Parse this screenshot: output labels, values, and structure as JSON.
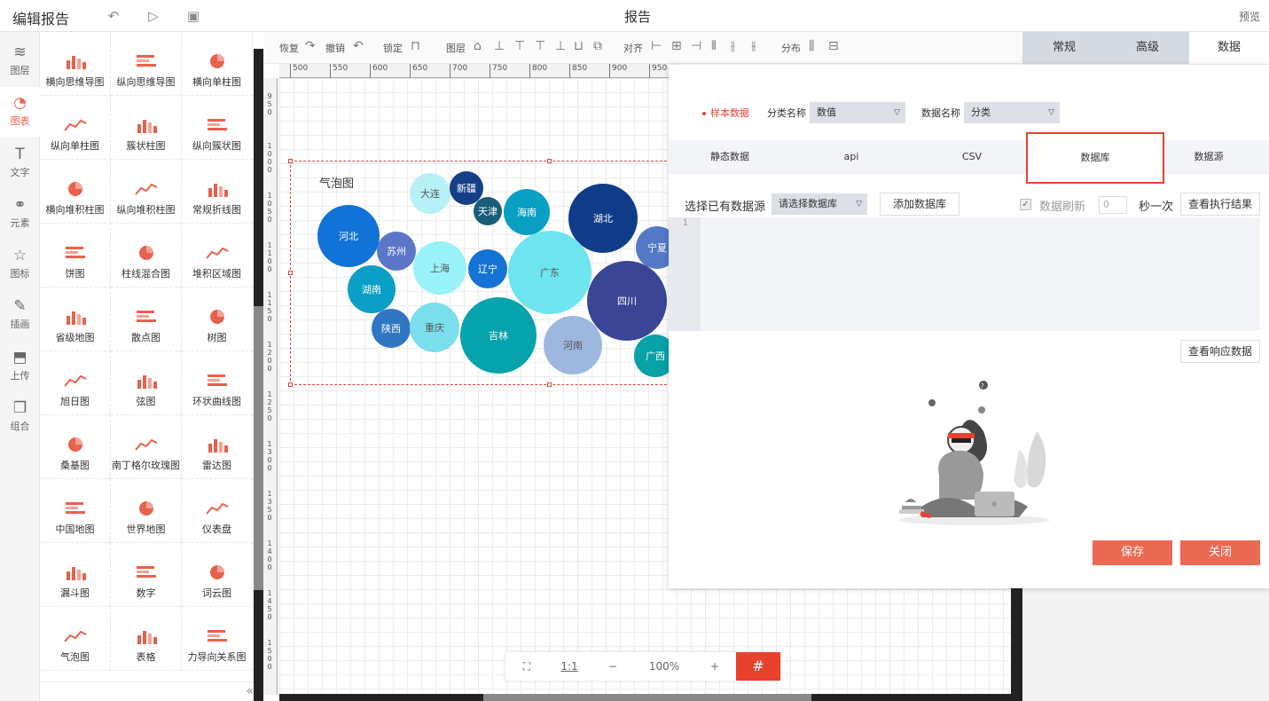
{
  "header": {
    "title": "编辑报告",
    "center": "报告",
    "preview": "预览"
  },
  "leftnav": [
    {
      "label": "图层",
      "icon": "layers-icon",
      "glyph": "≋"
    },
    {
      "label": "图表",
      "icon": "pie-chart-icon",
      "glyph": "◔"
    },
    {
      "label": "文字",
      "icon": "text-icon",
      "glyph": "T"
    },
    {
      "label": "元素",
      "icon": "shapes-icon",
      "glyph": "⚭"
    },
    {
      "label": "图标",
      "icon": "star-icon",
      "glyph": "☆"
    },
    {
      "label": "插画",
      "icon": "palette-icon",
      "glyph": "✎"
    },
    {
      "label": "上传",
      "icon": "upload-image-icon",
      "glyph": "⬒"
    },
    {
      "label": "组合",
      "icon": "group-icon",
      "glyph": "❐"
    }
  ],
  "palette": [
    "横向思维导图",
    "纵向思维导图",
    "横向单柱图",
    "纵向单柱图",
    "簇状柱图",
    "纵向簇状图",
    "横向堆积柱图",
    "纵向堆积柱图",
    "常规折线图",
    "饼图",
    "柱线混合图",
    "堆积区域图",
    "省级地图",
    "散点图",
    "树图",
    "旭日图",
    "弦图",
    "环状曲线图",
    "桑基图",
    "南丁格尔玫瑰图",
    "雷达图",
    "中国地图",
    "世界地图",
    "仪表盘",
    "漏斗图",
    "数字",
    "词云图",
    "气泡图",
    "表格",
    "力导向关系图"
  ],
  "toolbar": {
    "redo": "恢复",
    "undo": "撤销",
    "lock": "锁定",
    "layer": "图层",
    "align": "对齐",
    "distribute": "分布"
  },
  "ruler": [
    "500",
    "550",
    "600",
    "650",
    "700",
    "750",
    "800",
    "850",
    "900",
    "950"
  ],
  "ruler_left": [
    "950",
    "1000",
    "1050",
    "1100",
    "1150",
    "1200",
    "1250",
    "1300",
    "1350",
    "1400",
    "1450",
    "1500"
  ],
  "chart": {
    "title": "气泡图"
  },
  "bubbles": [
    {
      "label": "大连",
      "color": "#b7f1f7"
    },
    {
      "label": "新疆",
      "color": "#163f8a"
    },
    {
      "label": "天津",
      "color": "#1a5d7a"
    },
    {
      "label": "海南",
      "color": "#0aa0c4"
    },
    {
      "label": "湖北",
      "color": "#113c8a"
    },
    {
      "label": "河北",
      "color": "#1172d8"
    },
    {
      "label": "苏州",
      "color": "#5b76c9"
    },
    {
      "label": "上海",
      "color": "#98f2f8"
    },
    {
      "label": "辽宁",
      "color": "#1573d6"
    },
    {
      "label": "广东",
      "color": "#6ee5ee"
    },
    {
      "label": "宁夏",
      "color": "#5278c7"
    },
    {
      "label": "湖南",
      "color": "#0b9ec6"
    },
    {
      "label": "四川",
      "color": "#3a4596"
    },
    {
      "label": "陕西",
      "color": "#2f77c2"
    },
    {
      "label": "重庆",
      "color": "#7bdeec"
    },
    {
      "label": "吉林",
      "color": "#07a3ad"
    },
    {
      "label": "河南",
      "color": "#9db7de"
    },
    {
      "label": "广西",
      "color": "#07a1a8"
    }
  ],
  "zoom": {
    "ratio": "1:1",
    "minus": "−",
    "value": "100%",
    "plus": "+"
  },
  "rpanel": {
    "tabs": [
      "常规",
      "高级",
      "数据"
    ],
    "active": 2
  },
  "modal": {
    "sample": "样本数据",
    "category_label": "分类名称",
    "category_value": "数值",
    "data_label": "数据名称",
    "data_value": "分类",
    "tabs": [
      "静态数据",
      "api",
      "CSV",
      "数据库",
      "数据源"
    ],
    "active_tab": 3,
    "select_label": "选择已有数据源",
    "select_placeholder": "请选择数据库",
    "add_db": "添加数据库",
    "refresh": "数据刷新",
    "refresh_value": "0",
    "per": "秒一次",
    "exec_result": "查看执行结果",
    "line_no": "1",
    "response": "查看响应数据",
    "save": "保存",
    "close": "关闭"
  }
}
